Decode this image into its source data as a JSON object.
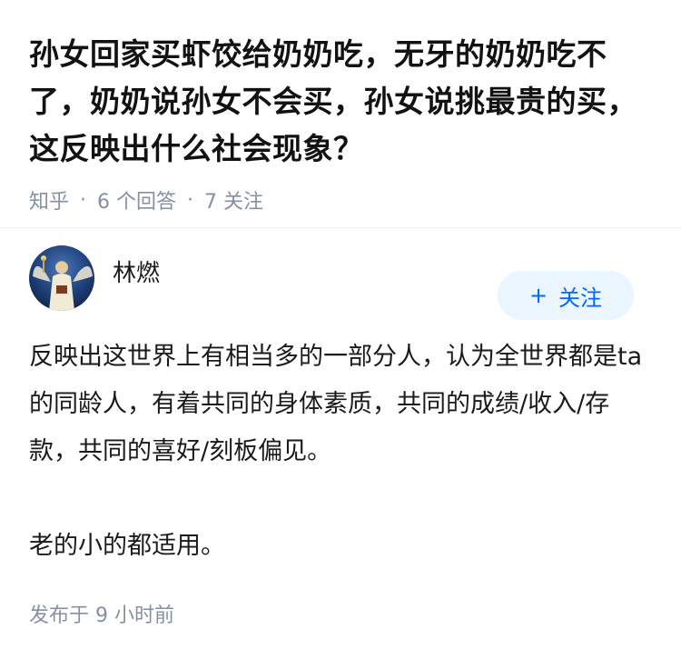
{
  "question": {
    "title": "孙女回家买虾饺给奶奶吃，无牙的奶奶吃不了，奶奶说孙女不会买，孙女说挑最贵的买，这反映出什么社会现象？",
    "source": "知乎",
    "answers_count": "6 个回答",
    "followers_count": "7 关注"
  },
  "answer": {
    "author_name": "林燃",
    "follow_label": "关注",
    "follow_plus": "+",
    "paragraph_1": "反映出这世界上有相当多的一部分人，认为全世界都是ta的同龄人，有着共同的身体素质，共同的成绩/收入/存款，共同的喜好/刻板偏见。",
    "paragraph_2": "老的小的都适用。",
    "posted_time": "发布于 9 小时前"
  },
  "colors": {
    "meta_text": "#8590a6",
    "follow_bg": "#ebf5ff",
    "follow_text": "#0066ff"
  },
  "icons": {
    "avatar": "angel-painting-avatar"
  }
}
